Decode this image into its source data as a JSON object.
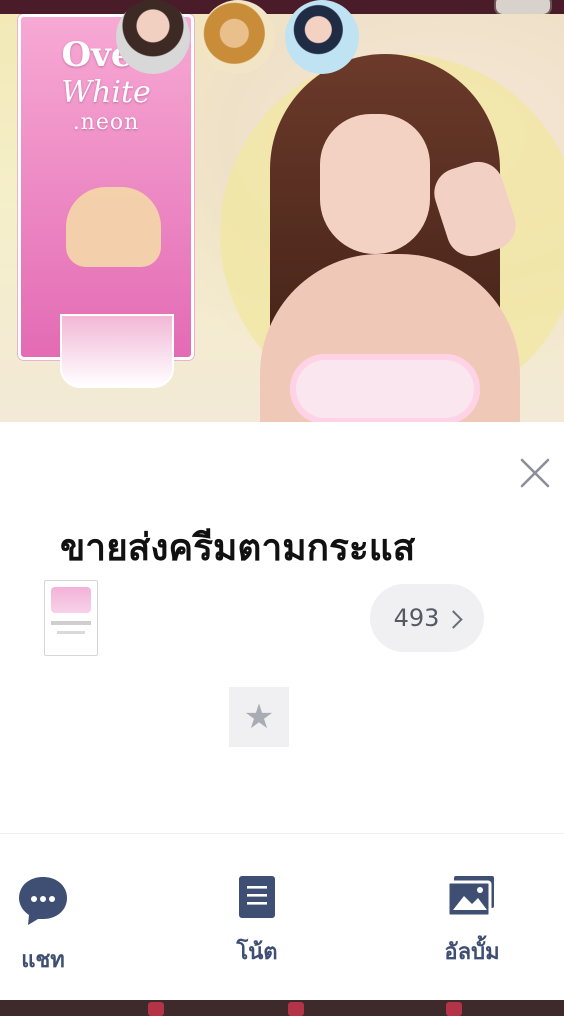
{
  "group": {
    "name": "ขายส่งครีมตามกระแส",
    "member_count": "493"
  },
  "cover": {
    "product_text_line1": "Over",
    "product_text_line2": "White",
    "product_text_line3": ".neon"
  },
  "nav": {
    "chat_label": "แชท",
    "note_label": "โน้ต",
    "album_label": "อัลบั้ม"
  },
  "colors": {
    "nav_icon": "#3f4f74",
    "title": "#111111",
    "pill_bg": "#f0f0f3",
    "close_icon": "#8a8f99"
  },
  "icons": {
    "close": "close-icon",
    "favorite": "star-icon",
    "chat": "chat-bubble-icon",
    "note": "note-icon",
    "album": "album-icon",
    "more": "chevron-right-icon"
  }
}
